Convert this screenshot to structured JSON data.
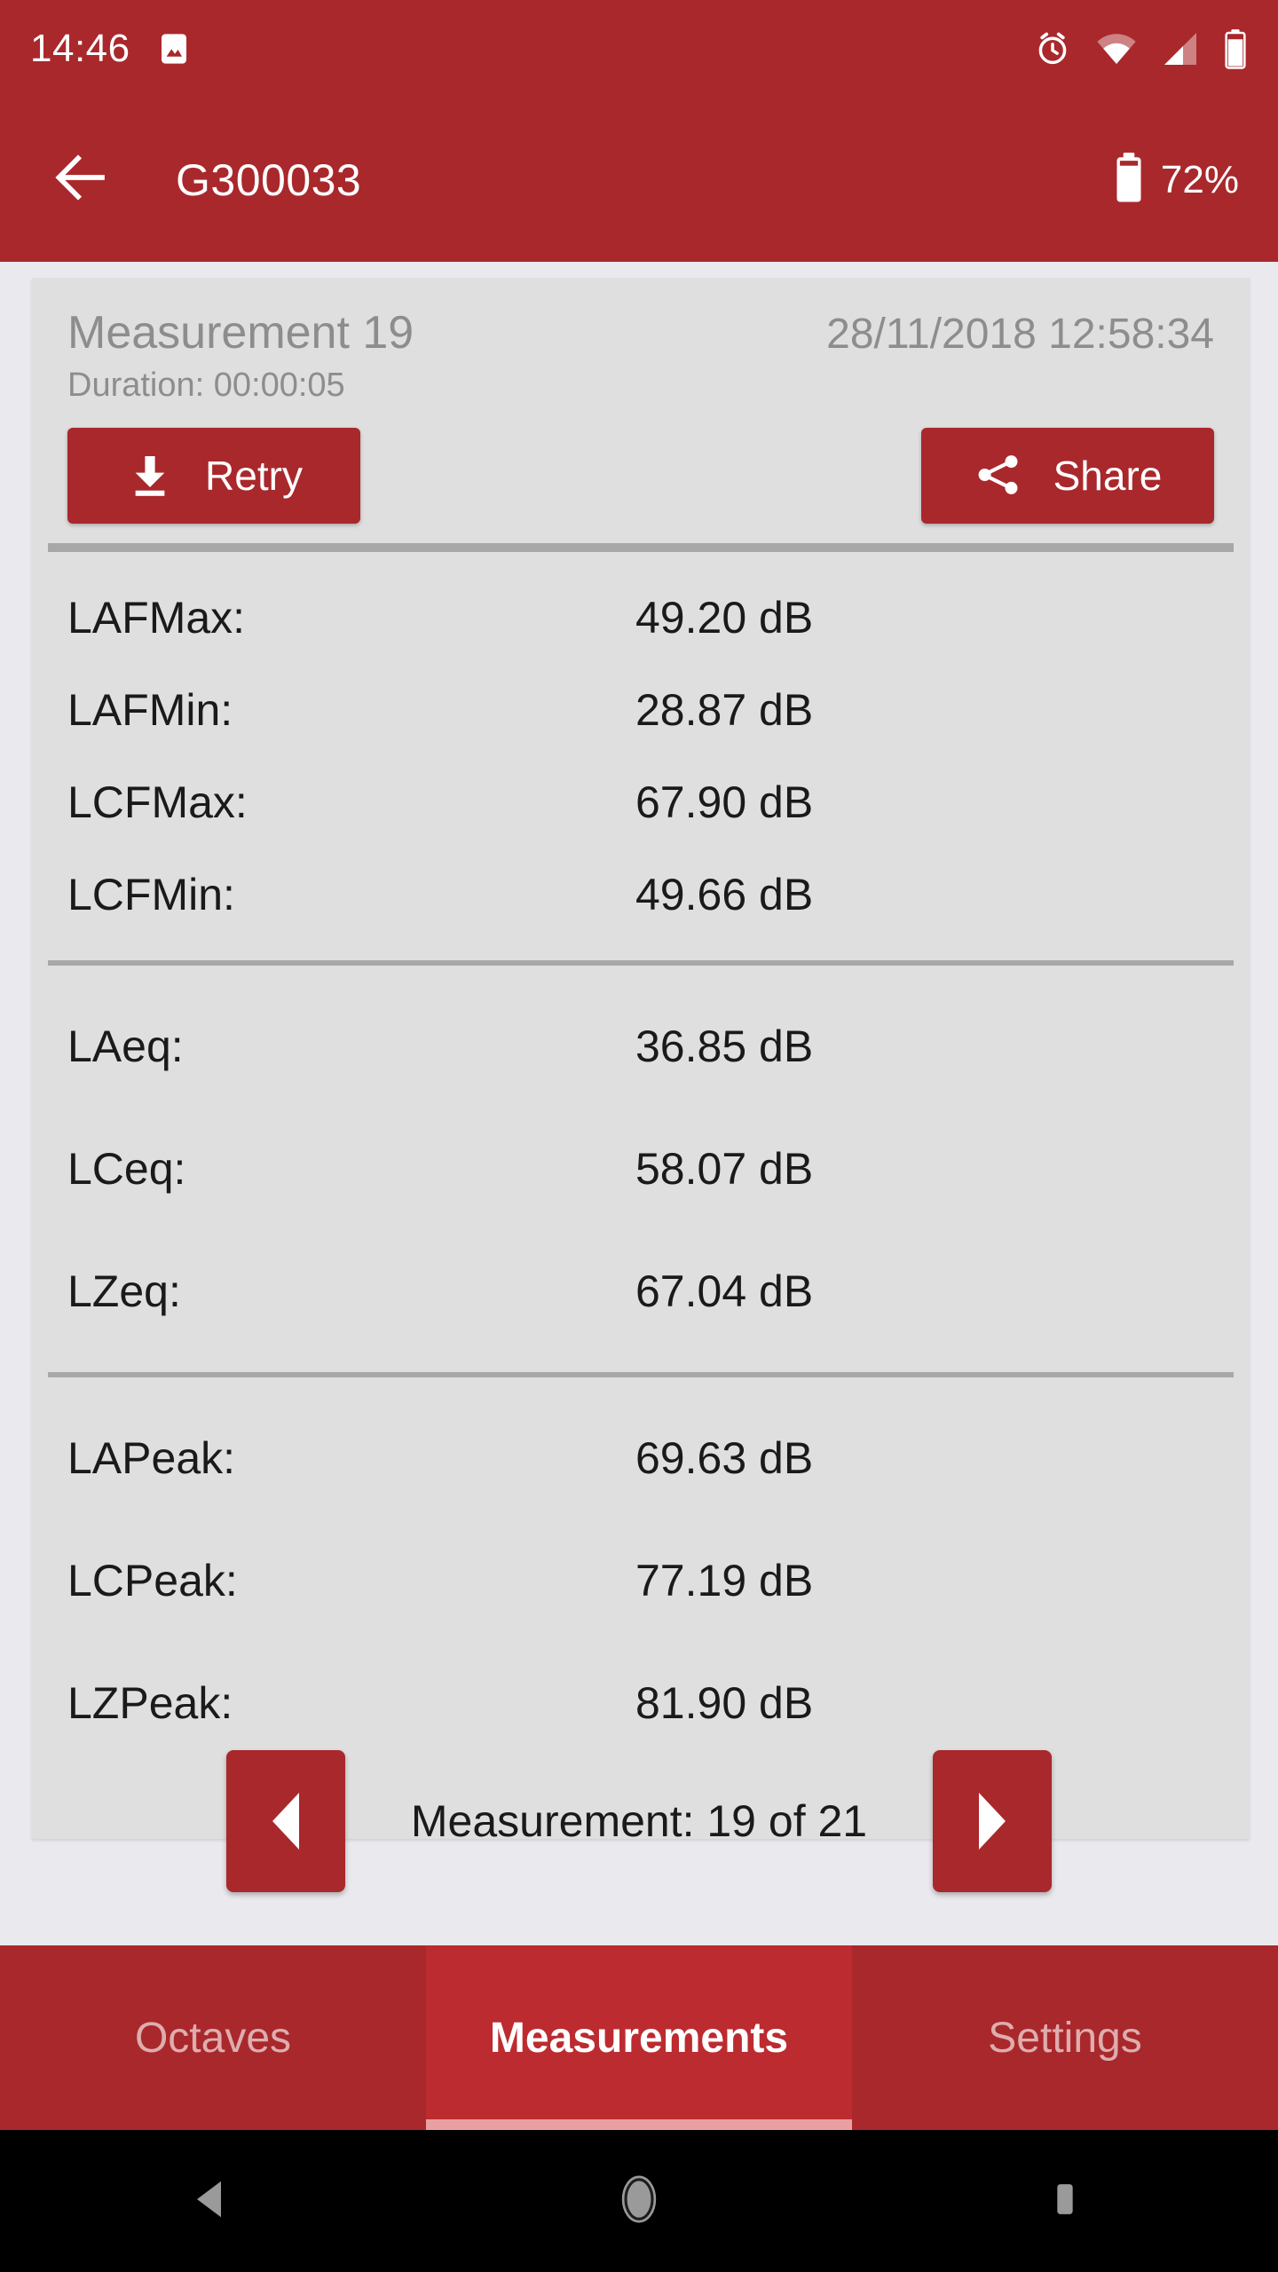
{
  "theme": {
    "primary": "#A9282C",
    "primary_active_tab": "#BC2B30",
    "page_background": "#EAE9ED",
    "card_background": "#DFDFDF",
    "divider": "#A8A8A8",
    "muted_text": "#8D8D8D",
    "body_text": "#1A1A1A",
    "tab_indicator": "#E8A0A2"
  },
  "status_bar": {
    "time": "14:46",
    "icons_left": [
      "image-icon"
    ],
    "icons_right": [
      "alarm-icon",
      "wifi-icon",
      "cellular-signal-icon",
      "battery-icon"
    ]
  },
  "app_bar": {
    "back_icon": "arrow-left-icon",
    "title": "G300033",
    "battery_icon": "battery-icon",
    "battery_percent": "72%"
  },
  "card": {
    "title": "Measurement 19",
    "datetime": "28/11/2018 12:58:34",
    "duration": "Duration: 00:00:05",
    "actions": [
      {
        "id": "retry",
        "label": "Retry",
        "icon": "download-icon"
      },
      {
        "id": "share",
        "label": "Share",
        "icon": "share-icon"
      }
    ],
    "groups": [
      {
        "id": "minmax",
        "rows": [
          {
            "label": "LAFMax:",
            "value": "49.20 dB"
          },
          {
            "label": "LAFMin:",
            "value": "28.87 dB"
          },
          {
            "label": "LCFMax:",
            "value": "67.90 dB"
          },
          {
            "label": "LCFMin:",
            "value": "49.66 dB"
          }
        ]
      },
      {
        "id": "equivalent",
        "rows": [
          {
            "label": "LAeq:",
            "value": "36.85 dB"
          },
          {
            "label": "LCeq:",
            "value": "58.07 dB"
          },
          {
            "label": "LZeq:",
            "value": "67.04 dB"
          }
        ]
      },
      {
        "id": "peak",
        "rows": [
          {
            "label": "LAPeak:",
            "value": "69.63 dB"
          },
          {
            "label": "LCPeak:",
            "value": "77.19 dB"
          },
          {
            "label": "LZPeak:",
            "value": "81.90 dB"
          }
        ]
      }
    ]
  },
  "pagination": {
    "prev_icon": "triangle-left-icon",
    "next_icon": "triangle-right-icon",
    "text": "Measurement: 19 of 21",
    "current": 19,
    "total": 21
  },
  "tabs": [
    {
      "id": "octaves",
      "label": "Octaves",
      "active": false
    },
    {
      "id": "measurements",
      "label": "Measurements",
      "active": true
    },
    {
      "id": "settings",
      "label": "Settings",
      "active": false
    }
  ],
  "nav_bar": {
    "items": [
      {
        "id": "back",
        "icon": "nav-back-triangle-icon"
      },
      {
        "id": "home",
        "icon": "nav-home-circle-icon"
      },
      {
        "id": "recents",
        "icon": "nav-recents-square-icon"
      }
    ]
  }
}
